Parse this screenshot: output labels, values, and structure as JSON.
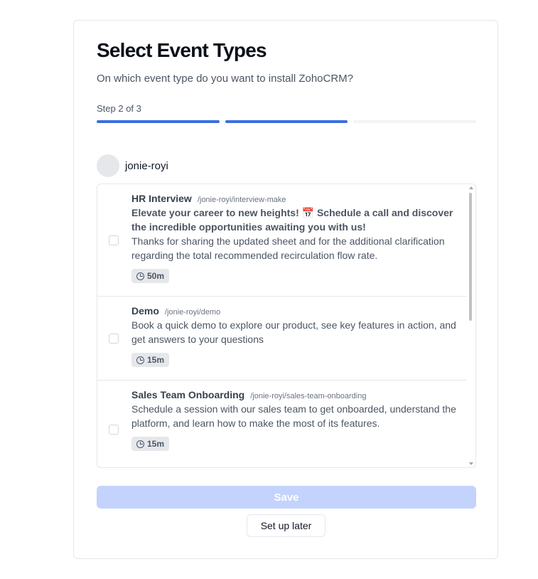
{
  "page": {
    "title": "Select Event Types",
    "subtitle": "On which event type do you want to install ZohoCRM?",
    "step_label": "Step 2 of 3",
    "progress": {
      "current": 2,
      "total": 3
    }
  },
  "user": {
    "username": "jonie-royi"
  },
  "event_types": [
    {
      "name": "HR Interview",
      "slug": "/jonie-royi/interview-make",
      "tagline": "Elevate your career to new heights! 📅 Schedule a call and discover the incredible opportunities awaiting you with us!",
      "description": "Thanks for sharing the updated sheet and for the additional clarification regarding the total recommended recirculation flow rate.",
      "duration": "50m"
    },
    {
      "name": "Demo",
      "slug": "/jonie-royi/demo",
      "description": "Book a quick demo to explore our product, see key features in action, and get answers to your questions",
      "duration": "15m"
    },
    {
      "name": "Sales Team Onboarding",
      "slug": "/jonie-royi/sales-team-onboarding",
      "description": "Schedule a session with our sales team to get onboarded, understand the platform, and learn how to make the most of its features.",
      "duration": "15m"
    }
  ],
  "actions": {
    "save_label": "Save",
    "later_label": "Set up later"
  },
  "colors": {
    "accent": "#3b6fe0",
    "save_disabled": "#c4d3fb"
  }
}
